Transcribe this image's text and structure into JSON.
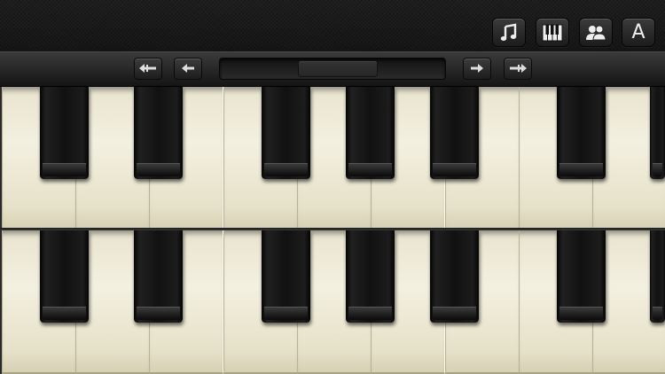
{
  "header": {
    "buttons": [
      {
        "name": "music-note-icon",
        "icon": "music-note-icon"
      },
      {
        "name": "piano-keys-icon",
        "icon": "piano-keys-icon"
      },
      {
        "name": "two-users-icon",
        "icon": "two-users-icon"
      },
      {
        "name": "font-icon",
        "icon": "font-icon",
        "label": "A"
      }
    ]
  },
  "navbar": {
    "buttons": [
      {
        "icon": "double-arrow-left-icon",
        "glyph": "⇠"
      },
      {
        "icon": "arrow-left-icon",
        "glyph": "←"
      },
      {
        "icon": "arrow-right-icon",
        "glyph": "→"
      },
      {
        "icon": "double-arrow-right-icon",
        "glyph": "⇢"
      }
    ]
  },
  "colors": {
    "ivory": "#f2eedc",
    "ebony": "#111111",
    "frame": "#2a2a2a"
  }
}
